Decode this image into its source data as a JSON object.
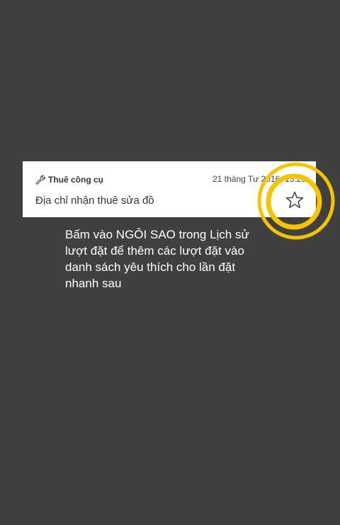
{
  "card": {
    "category": "Thuê công cụ",
    "timestamp": "21 tháng Tư 2016, 13:20",
    "address": "Địa chỉ nhận thuê sửa đồ",
    "category_icon": "wrench-icon",
    "favorite_icon": "star-outline-icon"
  },
  "tooltip": {
    "text": "Bấm vào NGÔI SAO trong Lịch sử lượt đặt để thêm các lượt đặt vào danh sách yêu thích cho lần đặt nhanh sau"
  },
  "colors": {
    "overlay": "#404040",
    "card": "#ffffff",
    "highlight": "#f5c400",
    "text_light": "#ffffff",
    "text_dark": "#333333"
  }
}
